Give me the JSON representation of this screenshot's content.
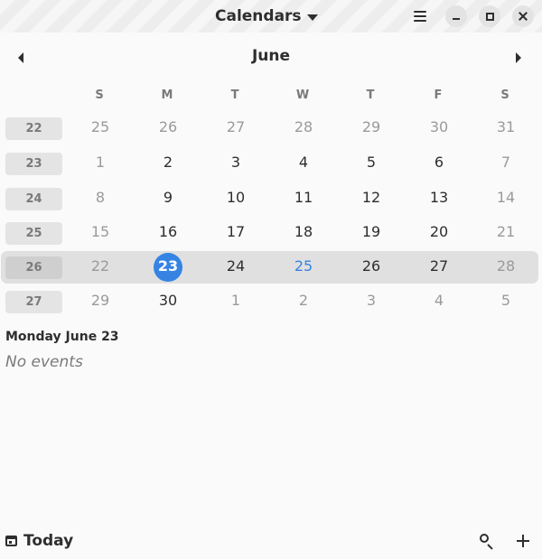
{
  "header": {
    "title": "Calendars",
    "menu_icon": "hamburger-menu-icon",
    "window_controls": [
      "minimize-icon",
      "maximize-icon",
      "close-icon"
    ]
  },
  "month_nav": {
    "month": "June",
    "prev_icon": "chevron-left-icon",
    "next_icon": "chevron-right-icon"
  },
  "weekdays": [
    "S",
    "M",
    "T",
    "W",
    "T",
    "F",
    "S"
  ],
  "weeks": [
    {
      "number": "22",
      "days": [
        {
          "label": "25",
          "state": "dim"
        },
        {
          "label": "26",
          "state": "dim"
        },
        {
          "label": "27",
          "state": "dim"
        },
        {
          "label": "28",
          "state": "dim"
        },
        {
          "label": "29",
          "state": "dim"
        },
        {
          "label": "30",
          "state": "dim"
        },
        {
          "label": "31",
          "state": "dim"
        }
      ]
    },
    {
      "number": "23",
      "days": [
        {
          "label": "1",
          "state": "dim"
        },
        {
          "label": "2",
          "state": "normal"
        },
        {
          "label": "3",
          "state": "normal"
        },
        {
          "label": "4",
          "state": "normal"
        },
        {
          "label": "5",
          "state": "normal"
        },
        {
          "label": "6",
          "state": "normal"
        },
        {
          "label": "7",
          "state": "dim"
        }
      ]
    },
    {
      "number": "24",
      "days": [
        {
          "label": "8",
          "state": "dim"
        },
        {
          "label": "9",
          "state": "normal"
        },
        {
          "label": "10",
          "state": "normal"
        },
        {
          "label": "11",
          "state": "normal"
        },
        {
          "label": "12",
          "state": "normal"
        },
        {
          "label": "13",
          "state": "normal"
        },
        {
          "label": "14",
          "state": "dim"
        }
      ]
    },
    {
      "number": "25",
      "days": [
        {
          "label": "15",
          "state": "dim"
        },
        {
          "label": "16",
          "state": "normal"
        },
        {
          "label": "17",
          "state": "normal"
        },
        {
          "label": "18",
          "state": "normal"
        },
        {
          "label": "19",
          "state": "normal"
        },
        {
          "label": "20",
          "state": "normal"
        },
        {
          "label": "21",
          "state": "dim"
        }
      ]
    },
    {
      "number": "26",
      "current": true,
      "days": [
        {
          "label": "22",
          "state": "dim"
        },
        {
          "label": "23",
          "state": "selected"
        },
        {
          "label": "24",
          "state": "normal"
        },
        {
          "label": "25",
          "state": "accent"
        },
        {
          "label": "26",
          "state": "normal"
        },
        {
          "label": "27",
          "state": "normal"
        },
        {
          "label": "28",
          "state": "dim"
        }
      ]
    },
    {
      "number": "27",
      "days": [
        {
          "label": "29",
          "state": "dim"
        },
        {
          "label": "30",
          "state": "normal"
        },
        {
          "label": "1",
          "state": "dim"
        },
        {
          "label": "2",
          "state": "dim"
        },
        {
          "label": "3",
          "state": "dim"
        },
        {
          "label": "4",
          "state": "dim"
        },
        {
          "label": "5",
          "state": "dim"
        }
      ]
    }
  ],
  "agenda": {
    "date_heading": "Monday June 23",
    "empty_text": "No events"
  },
  "footer": {
    "today_label": "Today",
    "today_icon": "calendar-today-icon",
    "search_icon": "search-icon",
    "add_icon": "add-icon"
  },
  "colors": {
    "accent": "#3584e4",
    "text": "#2e2e2e",
    "dim_text": "#9a9a9a",
    "background": "#fafafa"
  }
}
